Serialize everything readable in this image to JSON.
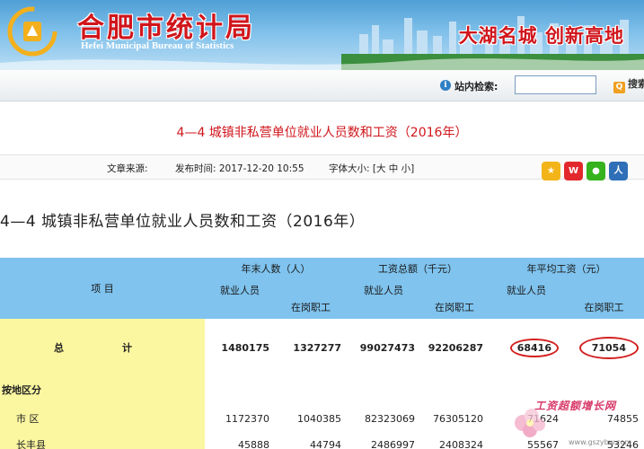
{
  "header": {
    "title": "合肥市统计局",
    "subtitle": "Hefei Municipal Bureau of Statistics",
    "slogan": "大湖名城  创新高地"
  },
  "search": {
    "label": "站内检索:",
    "value": "",
    "button_label": "搜索"
  },
  "article": {
    "title": "4—4  城镇非私营单位就业人员数和工资（2016年）",
    "source_label": "文章来源:",
    "publish_label": "发布时间: 2017-12-20 10:55",
    "fontsize_label": "字体大小: [大 中 小]",
    "share_icons": [
      "star-share-icon",
      "weibo-icon",
      "wechat-icon",
      "renren-icon"
    ]
  },
  "document": {
    "heading": "4—4    城镇非私营单位就业人员数和工资（2016年）"
  },
  "table": {
    "project_header": "项    目",
    "groups": [
      "年末人数（人）",
      "工资总额（千元）",
      "年平均工资（元）"
    ],
    "subheaders": [
      "就业人员",
      "在岗职工",
      "就业人员",
      "在岗职工",
      "就业人员",
      "在岗职工"
    ],
    "total_label_left": "总",
    "total_label_right": "计",
    "total_values": [
      "1480175",
      "1327277",
      "99027473",
      "92206287",
      "68416",
      "71054"
    ],
    "section_label": "按地区分",
    "rows": [
      {
        "label": "市    区",
        "values": [
          "1172370",
          "1040385",
          "82323069",
          "76305120",
          "71624",
          "74855"
        ]
      },
      {
        "label": "长丰县",
        "values": [
          "45888",
          "44794",
          "2486997",
          "2408324",
          "55567",
          "53246"
        ]
      }
    ]
  },
  "watermark": {
    "text": "工资超额增长网",
    "url": "www.gszybw.com"
  },
  "colors": {
    "brand_red": "#d0161c",
    "table_header": "#7fc3ee",
    "highlight_yellow": "#fbf7a0"
  }
}
